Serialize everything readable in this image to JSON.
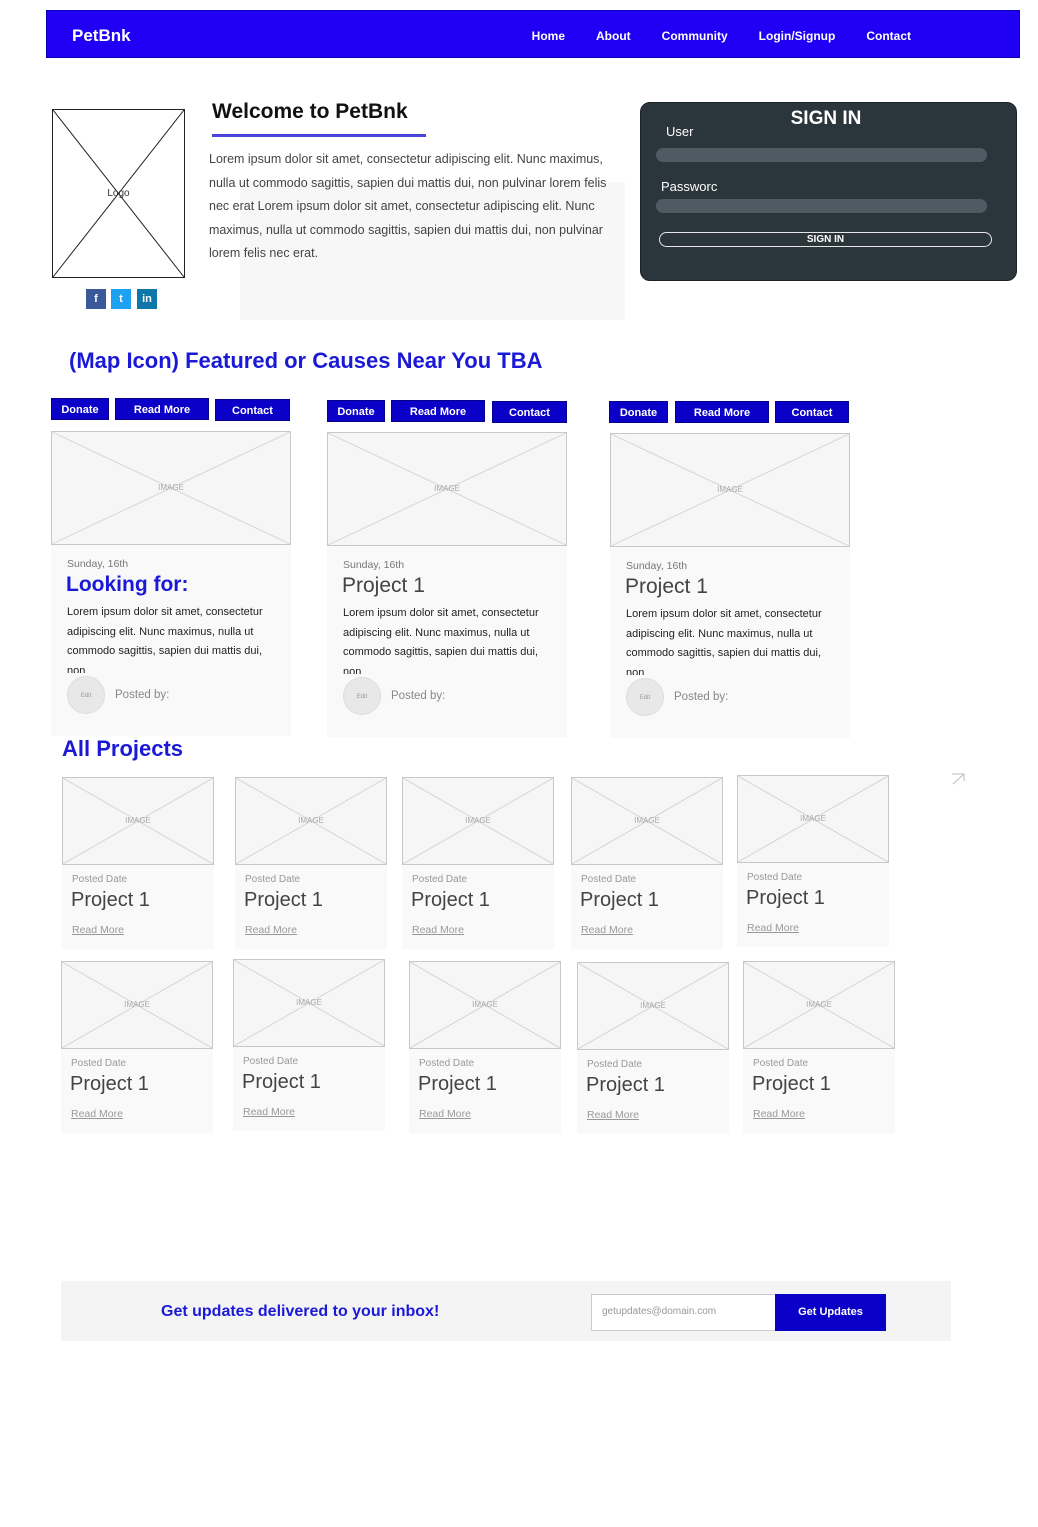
{
  "nav": {
    "brand": "PetBnk",
    "links": [
      "Home",
      "About",
      "Community",
      "Login/Signup",
      "Contact"
    ]
  },
  "logo": {
    "label": "Logo"
  },
  "social": [
    {
      "icon": "facebook-icon",
      "glyph": "f",
      "color": "#3b5998"
    },
    {
      "icon": "twitter-icon",
      "glyph": "t",
      "color": "#1da1f2"
    },
    {
      "icon": "linkedin-icon",
      "glyph": "in",
      "color": "#0e76a8"
    }
  ],
  "welcome": {
    "title": "Welcome to PetBnk",
    "text": "Lorem ipsum dolor sit amet, consectetur adipiscing elit. Nunc maximus, nulla ut commodo sagittis, sapien dui mattis dui, non pulvinar lorem felis nec erat Lorem ipsum dolor sit amet, consectetur adipiscing elit. Nunc maximus, nulla ut commodo sagittis, sapien dui mattis dui, non pulvinar lorem felis nec erat."
  },
  "signin": {
    "title": "SIGN IN",
    "user_label": "User",
    "password_label": "Passworc",
    "button": "SIGN IN"
  },
  "featured": {
    "title": "(Map Icon) Featured or Causes Near You TBA",
    "buttons": {
      "donate": "Donate",
      "read_more": "Read More",
      "contact": "Contact"
    },
    "image_label": "IMAGE",
    "avatar_label": "Edit",
    "cards": [
      {
        "date": "Sunday, 16th",
        "title": "Looking for:",
        "body": "Lorem ipsum dolor sit amet, consectetur adipiscing elit. Nunc maximus, nulla ut commodo sagittis, sapien dui mattis dui, non",
        "posted": "Posted by:"
      },
      {
        "date": "Sunday, 16th",
        "title": "Project 1",
        "body": "Lorem ipsum dolor sit amet, consectetur adipiscing elit. Nunc maximus, nulla ut commodo sagittis, sapien dui mattis dui, non",
        "posted": "Posted by:"
      },
      {
        "date": "Sunday, 16th",
        "title": "Project 1",
        "body": "Lorem ipsum dolor sit amet, consectetur adipiscing elit. Nunc maximus, nulla ut commodo sagittis, sapien dui mattis dui, non",
        "posted": "Posted by:"
      }
    ]
  },
  "all_projects": {
    "title": "All Projects",
    "image_label": "IMAGE",
    "items": [
      {
        "date": "Posted Date",
        "title": "Project 1",
        "link": "Read More"
      },
      {
        "date": "Posted Date",
        "title": "Project 1",
        "link": "Read More"
      },
      {
        "date": "Posted Date",
        "title": "Project 1",
        "link": "Read More"
      },
      {
        "date": "Posted Date",
        "title": "Project 1",
        "link": "Read More"
      },
      {
        "date": "Posted Date",
        "title": "Project 1",
        "link": "Read More"
      },
      {
        "date": "Posted Date",
        "title": "Project 1",
        "link": "Read More"
      },
      {
        "date": "Posted Date",
        "title": "Project 1",
        "link": "Read More"
      },
      {
        "date": "Posted Date",
        "title": "Project 1",
        "link": "Read More"
      },
      {
        "date": "Posted Date",
        "title": "Project 1",
        "link": "Read More"
      },
      {
        "date": "Posted Date",
        "title": "Project 1",
        "link": "Read More"
      }
    ]
  },
  "newsletter": {
    "text": "Get updates delivered to your inbox!",
    "placeholder": "getupdates@domain.com",
    "button": "Get Updates"
  },
  "colors": {
    "nav": "#1f00f5",
    "accent": "#1a1ad6",
    "button": "#0a00c8",
    "signin_panel": "#2b353c"
  }
}
